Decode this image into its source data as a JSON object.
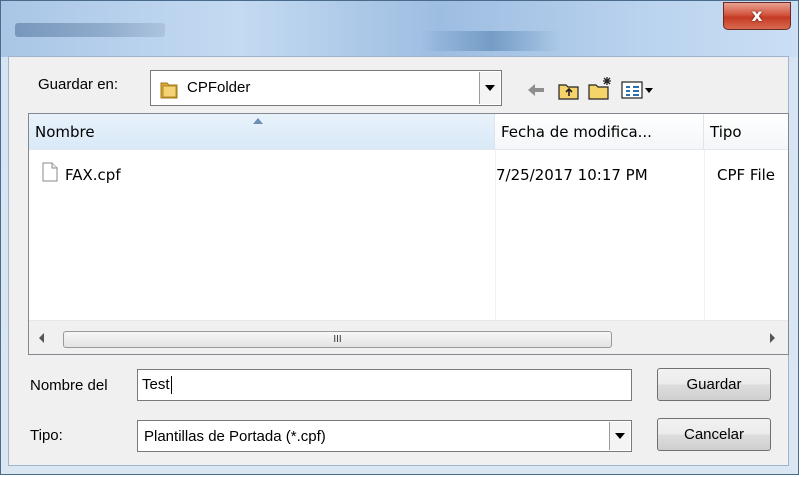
{
  "window": {
    "title_obscured": "",
    "close_label": "x"
  },
  "toolbar": {
    "save_in_label": "Guardar en:",
    "location_value": "CPFolder",
    "icons": [
      "folder-icon",
      "back-arrow-icon",
      "up-folder-icon",
      "new-folder-icon",
      "view-menu-icon"
    ]
  },
  "list": {
    "columns": [
      "Nombre",
      "Fecha de modifica...",
      "Tipo"
    ],
    "sorted_column": "Nombre",
    "rows": [
      {
        "name": "FAX.cpf",
        "date": "7/25/2017 10:17 PM",
        "type": "CPF File"
      }
    ],
    "scroll_thumb_grip": "III"
  },
  "form": {
    "filename_label": "Nombre del",
    "filename_value": "Test",
    "type_label": "Tipo:",
    "type_value": "Plantillas de Portada (*.cpf)"
  },
  "buttons": {
    "save": "Guardar",
    "cancel": "Cancelar"
  },
  "colors": {
    "title_gradient": "#b9d2ee",
    "close_red": "#c43a24",
    "client_bg": "#f0f0f0"
  }
}
